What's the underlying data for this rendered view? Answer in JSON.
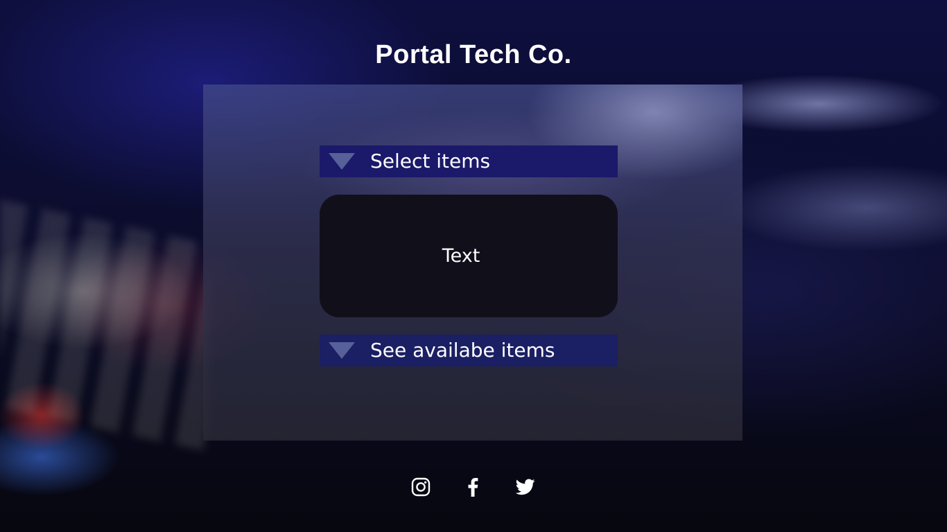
{
  "header": {
    "title": "Portal Tech Co."
  },
  "main": {
    "select_dropdown": {
      "label": "Select items"
    },
    "text_box": {
      "text": "Text"
    },
    "available_dropdown": {
      "label": "See availabe items"
    }
  },
  "footer": {
    "social": [
      {
        "icon": "instagram-icon"
      },
      {
        "icon": "facebook-icon"
      },
      {
        "icon": "twitter-icon"
      }
    ]
  },
  "colors": {
    "dropdown_bg": "#1a196a",
    "text_box_bg": "#110f1a",
    "triangle": "#58609a",
    "text": "#ffffff"
  }
}
